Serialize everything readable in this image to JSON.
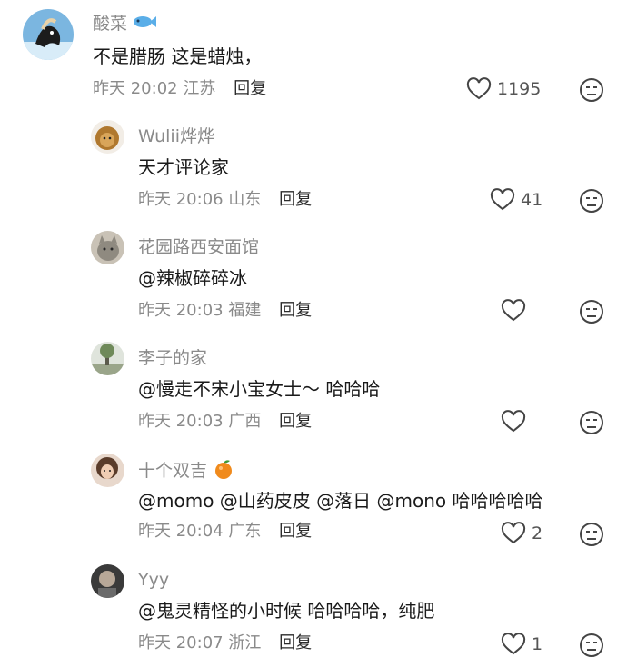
{
  "comments": [
    {
      "username": "酸菜",
      "text": "不是腊肠 这是蜡烛，",
      "time": "昨天 20:02",
      "location": "江苏",
      "reply": "回复",
      "likes": "1195",
      "badge": "fish-icon"
    },
    {
      "username": "Wulii烨烨",
      "text": "天才评论家",
      "time": "昨天 20:06",
      "location": "山东",
      "reply": "回复",
      "likes": "41"
    },
    {
      "username": "花园路西安面馆",
      "text": "@辣椒碎碎冰",
      "time": "昨天 20:03",
      "location": "福建",
      "reply": "回复",
      "likes": ""
    },
    {
      "username": "李子的家",
      "text": "@慢走不宋小宝女士～ 哈哈哈",
      "time": "昨天 20:03",
      "location": "广西",
      "reply": "回复",
      "likes": ""
    },
    {
      "username": "十个双吉",
      "text": "@momo @山药皮皮 @落日 @mono 哈哈哈哈哈",
      "time": "昨天 20:04",
      "location": "广东",
      "reply": "回复",
      "likes": "2",
      "badge": "orange-icon"
    },
    {
      "username": "Yyy",
      "text": "@鬼灵精怪的小时候 哈哈哈哈，纯肥",
      "time": "昨天 20:07",
      "location": "浙江",
      "reply": "回复",
      "likes": "1"
    }
  ],
  "colors": {
    "username": "#8a8a8a",
    "text": "#1a1a1a",
    "icon": "#444444"
  }
}
